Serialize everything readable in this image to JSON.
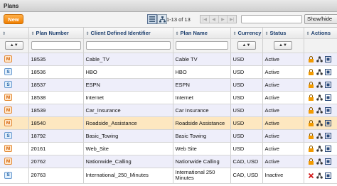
{
  "window": {
    "title": "Plans"
  },
  "toolbar": {
    "new_label": "New",
    "count_label": "1-13 of 13",
    "search_value": "",
    "show_hide_label": "Show/hide"
  },
  "colors": {
    "accent": "#f08a00",
    "header_text": "#1d3f6e",
    "row_alt": "#eeeefa",
    "row_highlight": "#fde7c0"
  },
  "table": {
    "columns": [
      {
        "key": "type",
        "label": ""
      },
      {
        "key": "plan_number",
        "label": "Plan Number"
      },
      {
        "key": "client_id",
        "label": "Client Defined Identifier"
      },
      {
        "key": "plan_name",
        "label": "Plan Name"
      },
      {
        "key": "currency",
        "label": "Currency"
      },
      {
        "key": "status",
        "label": "Status"
      },
      {
        "key": "actions",
        "label": "Actions"
      }
    ],
    "rows": [
      {
        "type": "M",
        "plan_number": "18535",
        "client_id": "Cable_TV",
        "plan_name": "Cable TV",
        "currency": "USD",
        "status": "Active",
        "lock": "lock-icon"
      },
      {
        "type": "S",
        "plan_number": "18536",
        "client_id": "HBO",
        "plan_name": "HBO",
        "currency": "USD",
        "status": "Active",
        "lock": "lock-icon"
      },
      {
        "type": "S",
        "plan_number": "18537",
        "client_id": "ESPN",
        "plan_name": "ESPN",
        "currency": "USD",
        "status": "Active",
        "lock": "lock-icon"
      },
      {
        "type": "M",
        "plan_number": "18538",
        "client_id": "Internet",
        "plan_name": "Internet",
        "currency": "USD",
        "status": "Active",
        "lock": "lock-icon"
      },
      {
        "type": "M",
        "plan_number": "18539",
        "client_id": "Car_Insurance",
        "plan_name": "Car Insurance",
        "currency": "USD",
        "status": "Active",
        "lock": "lock-icon"
      },
      {
        "type": "M",
        "plan_number": "18540",
        "client_id": "Roadside_Assistance",
        "plan_name": "Roadside Assistance",
        "currency": "USD",
        "status": "Active",
        "lock": "lock-icon",
        "highlight": true
      },
      {
        "type": "S",
        "plan_number": "18792",
        "client_id": "Basic_Towing",
        "plan_name": "Basic Towing",
        "currency": "USD",
        "status": "Active",
        "lock": "lock-icon"
      },
      {
        "type": "M",
        "plan_number": "20161",
        "client_id": "Web_Site",
        "plan_name": "Web Site",
        "currency": "USD",
        "status": "Active",
        "lock": "lock-icon"
      },
      {
        "type": "M",
        "plan_number": "20762",
        "client_id": "Nationwide_Calling",
        "plan_name": "Nationwide Calling",
        "currency": "CAD, USD",
        "status": "Active",
        "lock": "lock-icon"
      },
      {
        "type": "S",
        "plan_number": "20763",
        "client_id": "International_250_Minutes",
        "plan_name": "International 250 Minutes",
        "currency": "CAD, USD",
        "status": "Inactive",
        "lock": "delete-icon",
        "tall": true
      }
    ]
  }
}
